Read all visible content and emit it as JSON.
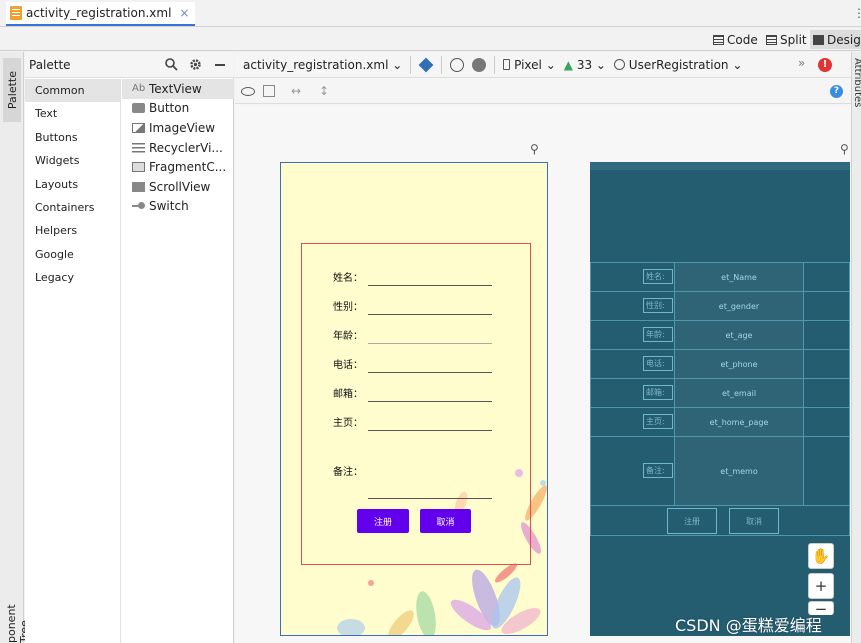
{
  "tab": {
    "filename": "activity_registration.xml",
    "close": "×"
  },
  "view_modes": {
    "code": "Code",
    "split": "Split",
    "design": "Design"
  },
  "left_strip": {
    "palette": "Palette",
    "component_tree": "ponent Tree"
  },
  "right_strip": {
    "attributes": "Attributes"
  },
  "palette": {
    "title": "Palette",
    "categories": [
      "Common",
      "Text",
      "Buttons",
      "Widgets",
      "Layouts",
      "Containers",
      "Helpers",
      "Google",
      "Legacy"
    ],
    "items": [
      {
        "prefix": "Ab",
        "label": "TextView"
      },
      {
        "label": "Button"
      },
      {
        "label": "ImageView"
      },
      {
        "label": "RecyclerVi..."
      },
      {
        "label": "FragmentC..."
      },
      {
        "label": "ScrollView"
      },
      {
        "label": "Switch"
      }
    ]
  },
  "toolbar": {
    "file": "activity_registration.xml",
    "device": "Pixel",
    "api": "33",
    "theme": "UserRegistration",
    "more": "»"
  },
  "form": {
    "labels": [
      "姓名：",
      "性别：",
      "年龄：",
      "电话：",
      "邮箱：",
      "主页：",
      "备注："
    ],
    "register": "注册",
    "cancel": "取消"
  },
  "blueprint": {
    "labels": [
      "姓名:",
      "性别:",
      "年龄:",
      "电话:",
      "邮箱:",
      "主页:",
      "备注:"
    ],
    "fields": [
      "et_Name",
      "et_gender",
      "et_age",
      "et_phone",
      "et_email",
      "et_home_page",
      "et_memo"
    ],
    "register": "注册",
    "cancel": "取消"
  },
  "colors": {
    "accent": "#6200ee",
    "blueprint": "#245c70",
    "form_border": "#e05050",
    "phone_bg": "#fffccd"
  },
  "watermark": "CSDN @蛋糕爱编程"
}
